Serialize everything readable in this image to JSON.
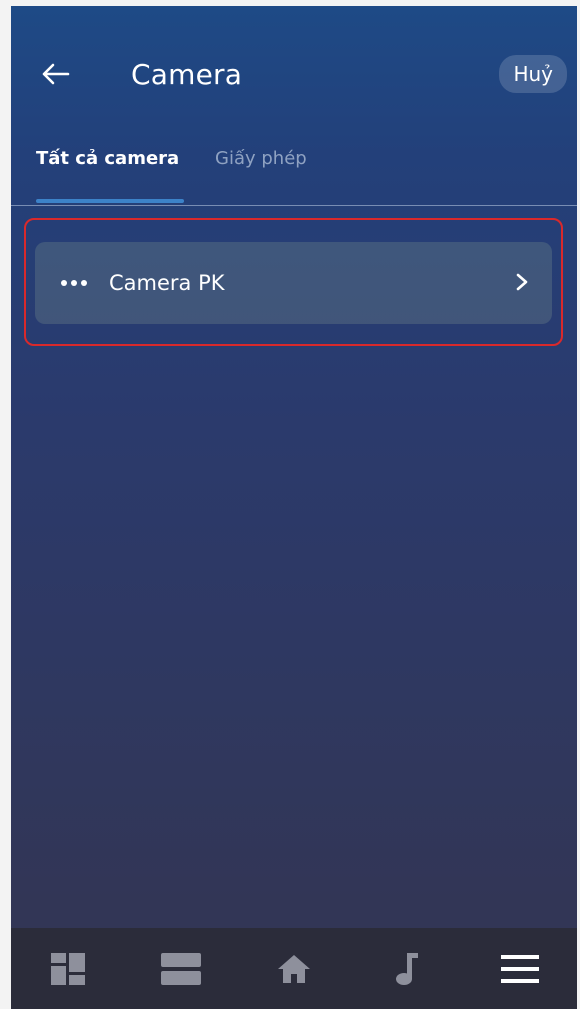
{
  "header": {
    "title": "Camera",
    "cancel_label": "Huỷ",
    "back_icon": "arrow-left-icon"
  },
  "tabs": [
    {
      "label": "Tất cả camera",
      "active": true
    },
    {
      "label": "Giấy phép",
      "active": false
    }
  ],
  "cameras": [
    {
      "name": "Camera PK",
      "icon": "more-dots-icon",
      "trailing_icon": "chevron-right-icon"
    }
  ],
  "bottom_nav": [
    {
      "icon": "dashboard-grid-icon"
    },
    {
      "icon": "rooms-list-icon"
    },
    {
      "icon": "home-icon"
    },
    {
      "icon": "music-note-icon"
    },
    {
      "icon": "menu-icon",
      "active": true
    }
  ],
  "colors": {
    "highlight_border": "#d9292b",
    "tab_indicator": "#3c82c9",
    "nav_active": "#ffffff",
    "nav_inactive": "#8e909c"
  }
}
